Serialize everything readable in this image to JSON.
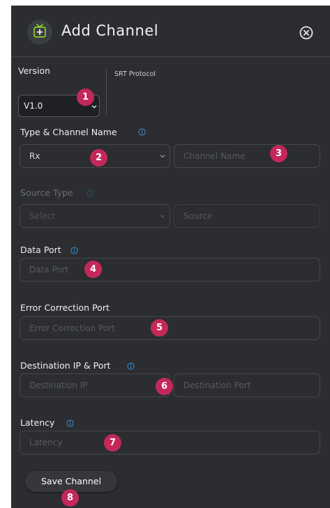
{
  "dialog": {
    "title": "Add Channel",
    "icon": "tv-add-icon",
    "close_icon": "close-circle-icon"
  },
  "version": {
    "label": "Version",
    "protocol_label": "SRT Protocol",
    "selected": "V1.0"
  },
  "type_channel": {
    "label": "Type & Channel Name",
    "type_value": "Rx",
    "channel_placeholder": "Channel Name"
  },
  "source_type": {
    "label": "Source Type",
    "select_placeholder": "Select",
    "source_placeholder": "Source"
  },
  "data_port": {
    "label": "Data Port",
    "placeholder": "Data Port"
  },
  "error_correction": {
    "label": "Error Correction Port",
    "placeholder": "Error Correction Port"
  },
  "destination": {
    "label": "Destination IP & Port",
    "ip_placeholder": "Destination IP",
    "port_placeholder": "Destination Port"
  },
  "latency": {
    "label": "Latency",
    "placeholder": "Latency"
  },
  "actions": {
    "save_label": "Save Channel"
  },
  "markers": [
    "1",
    "2",
    "3",
    "4",
    "5",
    "6",
    "7",
    "8"
  ],
  "colors": {
    "panel_bg": "#2b2d30",
    "marker": "#c4285a",
    "info_icon": "#3a8fd6",
    "tv_icon": "#8bd12a"
  }
}
